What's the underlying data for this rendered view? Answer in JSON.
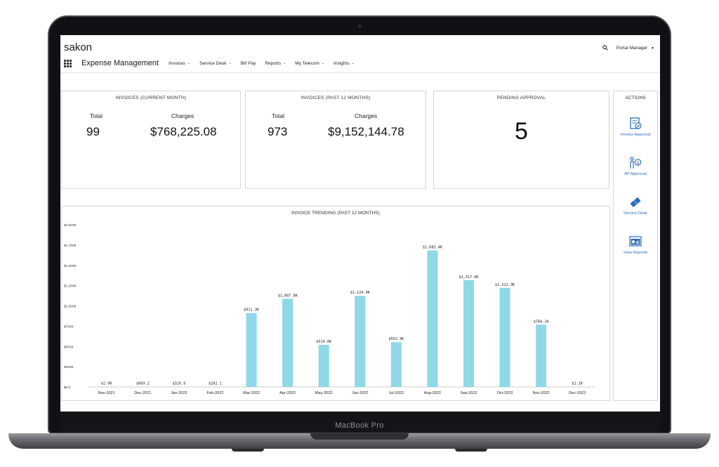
{
  "device": {
    "brand_label": "MacBook Pro"
  },
  "header": {
    "logo": "sakon",
    "user_menu": "Portal Manager",
    "app_title": "Expense Management",
    "nav": [
      {
        "label": "Invoices",
        "dropdown": true
      },
      {
        "label": "Service Desk",
        "dropdown": true
      },
      {
        "label": "Bill Pay",
        "dropdown": false
      },
      {
        "label": "Reports",
        "dropdown": true
      },
      {
        "label": "My Telecom",
        "dropdown": true
      },
      {
        "label": "Insights",
        "dropdown": true
      }
    ]
  },
  "cards": {
    "current_month": {
      "title": "INVOICES (CURRENT MONTH)",
      "total_label": "Total",
      "total_value": "99",
      "charges_label": "Charges",
      "charges_value": "$768,225.08"
    },
    "past_12": {
      "title": "INVOICES (PAST 12 MONTHS)",
      "total_label": "Total",
      "total_value": "973",
      "charges_label": "Charges",
      "charges_value": "$9,152,144.78"
    },
    "pending": {
      "title": "PENDING APPROVAL",
      "value": "5"
    }
  },
  "actions": {
    "title": "ACTIONS",
    "items": [
      {
        "label": "Invoice Approval",
        "icon": "invoice-approval-icon"
      },
      {
        "label": "AP Approval",
        "icon": "ap-approval-icon"
      },
      {
        "label": "Service Desk",
        "icon": "service-desk-icon"
      },
      {
        "label": "View Reports",
        "icon": "view-reports-icon"
      }
    ]
  },
  "colors": {
    "bar": "#8fd8e8",
    "accent": "#2a6ebb"
  },
  "chart_data": {
    "type": "bar",
    "title": "INVOICE TRENDING (PAST 12 MONTHS)",
    "categories": [
      "Nov-2021",
      "Dec-2021",
      "Jan-2022",
      "Feb-2022",
      "Mar-2022",
      "Apr-2022",
      "May-2022",
      "Jun-2022",
      "Jul-2022",
      "Aug-2022",
      "Sep-2022",
      "Oct-2022",
      "Nov-2022",
      "Dec-2022"
    ],
    "values": [
      2000,
      669.2,
      326.9,
      262.1,
      911300,
      1087800,
      519000,
      1124000,
      552300,
      1683400,
      1317900,
      1222300,
      768100,
      1100
    ],
    "data_labels": [
      "$2.0K",
      "$669.2",
      "$326.9",
      "$262.1",
      "$911.3K",
      "$1,087.8K",
      "$519.0K",
      "$1,124.0K",
      "$552.3K",
      "$1,683.4K",
      "$1,317.9K",
      "$1,222.3K",
      "$768.1K",
      "$1.1K"
    ],
    "yticks": [
      0,
      250000,
      500000,
      750000,
      1000000,
      1250000,
      1500000,
      1750000,
      2000000
    ],
    "ytick_labels": [
      "$0.0",
      "$250K",
      "$500K",
      "$750K",
      "$1,000K",
      "$1,250K",
      "$1,500K",
      "$1,750K",
      "$2,000K"
    ],
    "ylim": [
      0,
      2000000
    ],
    "grid": false
  }
}
